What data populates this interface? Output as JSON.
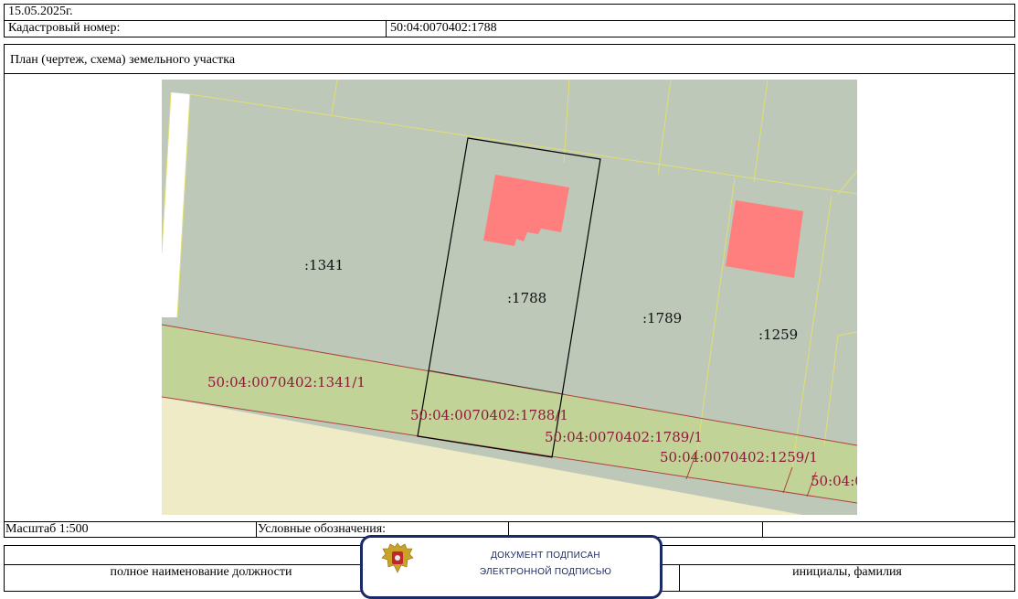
{
  "header": {
    "date": "15.05.2025г.",
    "cadastral_label": "Кадастровый номер:",
    "cadastral_value": "50:04:0070402:1788",
    "plan_title": "План (чертеж, схема) земельного участка"
  },
  "map": {
    "parcel_labels": [
      ":1341",
      ":1788",
      ":1789",
      ":1259"
    ],
    "part_labels": [
      "50:04:0070402:1341/1",
      "50:04:0070402:1788/1",
      "50:04:0070402:1789/1",
      "50:04:0070402:1259/1",
      "50:04:0"
    ],
    "colors": {
      "parcel_fill": "#bdc8b8",
      "part_fill": "#c2d398",
      "road_fill": "#eeebc6",
      "building_fill": "#ff7f7f",
      "boundary_line": "#e0e070",
      "part_line": "#b04040",
      "selected_outline": "#000000",
      "part_text": "#8b1a3a"
    }
  },
  "footer": {
    "scale": "Масштаб 1:500",
    "legend_label": "Условные обозначения:",
    "position_label": "полное наименование должности",
    "initials_label": "инициалы, фамилия"
  },
  "stamp": {
    "line1": "ДОКУМЕНТ ПОДПИСАН",
    "line2": "ЭЛЕКТРОННОЙ ПОДПИСЬЮ",
    "emblem_icon": "coat-of-arms-icon",
    "accent": "#1a2a66"
  }
}
